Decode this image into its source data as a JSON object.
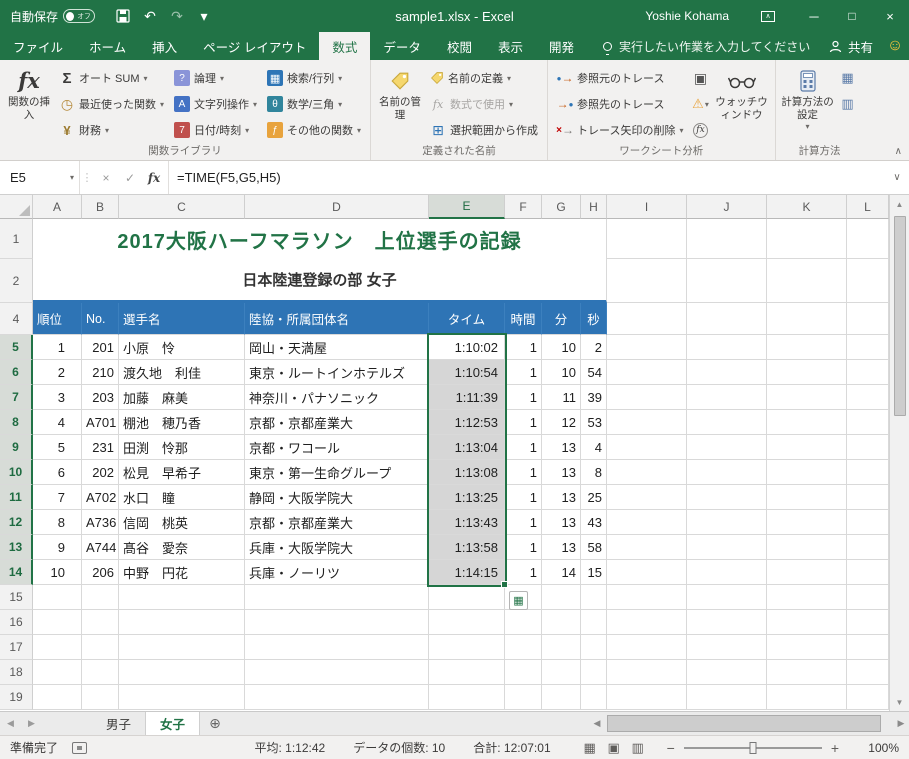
{
  "title_bar": {
    "autosave_label": "自動保存",
    "autosave_state": "オフ",
    "title": "sample1.xlsx -  Excel",
    "user": "Yoshie Kohama"
  },
  "ribbon_tabs": {
    "file": "ファイル",
    "home": "ホーム",
    "insert": "挿入",
    "page_layout": "ページ レイアウト",
    "formulas": "数式",
    "data": "データ",
    "review": "校閲",
    "view": "表示",
    "developer": "開発",
    "tell_me": "実行したい作業を入力してください",
    "share": "共有"
  },
  "ribbon": {
    "insert_function": "関数の挿入",
    "autosum": "オート SUM",
    "recent": "最近使った関数",
    "financial": "財務",
    "logical": "論理",
    "text_ops": "文字列操作",
    "datetime": "日付/時刻",
    "lookup": "検索/行列",
    "math": "数学/三角",
    "more_functions": "その他の関数",
    "function_library_label": "関数ライブラリ",
    "name_manager": "名前の管理",
    "define_name": "名前の定義",
    "use_in_formula": "数式で使用",
    "create_from_selection": "選択範囲から作成",
    "defined_names_label": "定義された名前",
    "trace_precedents": "参照元のトレース",
    "trace_dependents": "参照先のトレース",
    "remove_arrows": "トレース矢印の削除",
    "auditing_label": "ワークシート分析",
    "watch_window": "ウォッチウィンドウ",
    "calc_options": "計算方法の設定",
    "calculation_label": "計算方法"
  },
  "formula_bar": {
    "name_box": "E5",
    "formula": "=TIME(F5,G5,H5)"
  },
  "grid": {
    "columns": [
      "A",
      "B",
      "C",
      "D",
      "E",
      "F",
      "G",
      "H",
      "I",
      "J",
      "K",
      "L"
    ],
    "rows": [
      "1",
      "2",
      "4",
      "5",
      "6",
      "7",
      "8",
      "9",
      "10",
      "11",
      "12",
      "13",
      "14",
      "15",
      "16",
      "17",
      "18",
      "19"
    ],
    "title": "2017大阪ハーフマラソン　上位選手の記録",
    "subtitle": "日本陸連登録の部 女子",
    "headers": [
      "順位",
      "No.",
      "選手名",
      "陸協・所属団体名",
      "タイム",
      "時間",
      "分",
      "秒"
    ],
    "data": [
      [
        "1",
        "201",
        "小原　怜",
        "岡山・天満屋",
        "1:10:02",
        "1",
        "10",
        "2"
      ],
      [
        "2",
        "210",
        "渡久地　利佳",
        "東京・ルートインホテルズ",
        "1:10:54",
        "1",
        "10",
        "54"
      ],
      [
        "3",
        "203",
        "加藤　麻美",
        "神奈川・パナソニック",
        "1:11:39",
        "1",
        "11",
        "39"
      ],
      [
        "4",
        "A701",
        "棚池　穂乃香",
        "京都・京都産業大",
        "1:12:53",
        "1",
        "12",
        "53"
      ],
      [
        "5",
        "231",
        "田渕　怜那",
        "京都・ワコール",
        "1:13:04",
        "1",
        "13",
        "4"
      ],
      [
        "6",
        "202",
        "松見　早希子",
        "東京・第一生命グループ",
        "1:13:08",
        "1",
        "13",
        "8"
      ],
      [
        "7",
        "A702",
        "水口　瞳",
        "静岡・大阪学院大",
        "1:13:25",
        "1",
        "13",
        "25"
      ],
      [
        "8",
        "A736",
        "信岡　桃英",
        "京都・京都産業大",
        "1:13:43",
        "1",
        "13",
        "43"
      ],
      [
        "9",
        "A744",
        "髙谷　愛奈",
        "兵庫・大阪学院大",
        "1:13:58",
        "1",
        "13",
        "58"
      ],
      [
        "10",
        "206",
        "中野　円花",
        "兵庫・ノーリツ",
        "1:14:15",
        "1",
        "14",
        "15"
      ]
    ]
  },
  "sheet_tabs": {
    "tab1": "男子",
    "tab2": "女子"
  },
  "status_bar": {
    "ready": "準備完了",
    "average": "平均: 1:12:42",
    "count": "データの個数: 10",
    "sum": "合計: 12:07:01",
    "zoom": "100%"
  },
  "icons": {
    "dropdown": "▾",
    "undo": "↶",
    "redo": "↷",
    "minimize": "─",
    "maximize": "□",
    "close": "×",
    "cancel": "×",
    "check": "✓",
    "fx": "fx",
    "sigma": "Σ",
    "clock": "◷",
    "yen": "¥",
    "question": "?",
    "letter_a": "A",
    "calendar": "7",
    "grid": "▦",
    "theta": "θ",
    "fhook": "ƒ",
    "plusgrid": "⊞",
    "dot": "●",
    "arrow_right": "→",
    "cross_red": "×",
    "warning": "⚠",
    "chevron_up": "∧",
    "chevron_down": "∨",
    "dots": "⋮",
    "left": "◀",
    "right": "▶",
    "up": "▲",
    "down": "▼",
    "add_circle": "⊕",
    "smiley": "☺",
    "view_normal": "▦",
    "view_layout": "▣",
    "view_break": "▥",
    "zoom_minus": "−",
    "zoom_plus": "+"
  },
  "colors": {
    "excel_green": "#217346",
    "header_blue": "#2E74B5",
    "title_green": "#217346",
    "selection_fill": "#D6D6D6"
  }
}
